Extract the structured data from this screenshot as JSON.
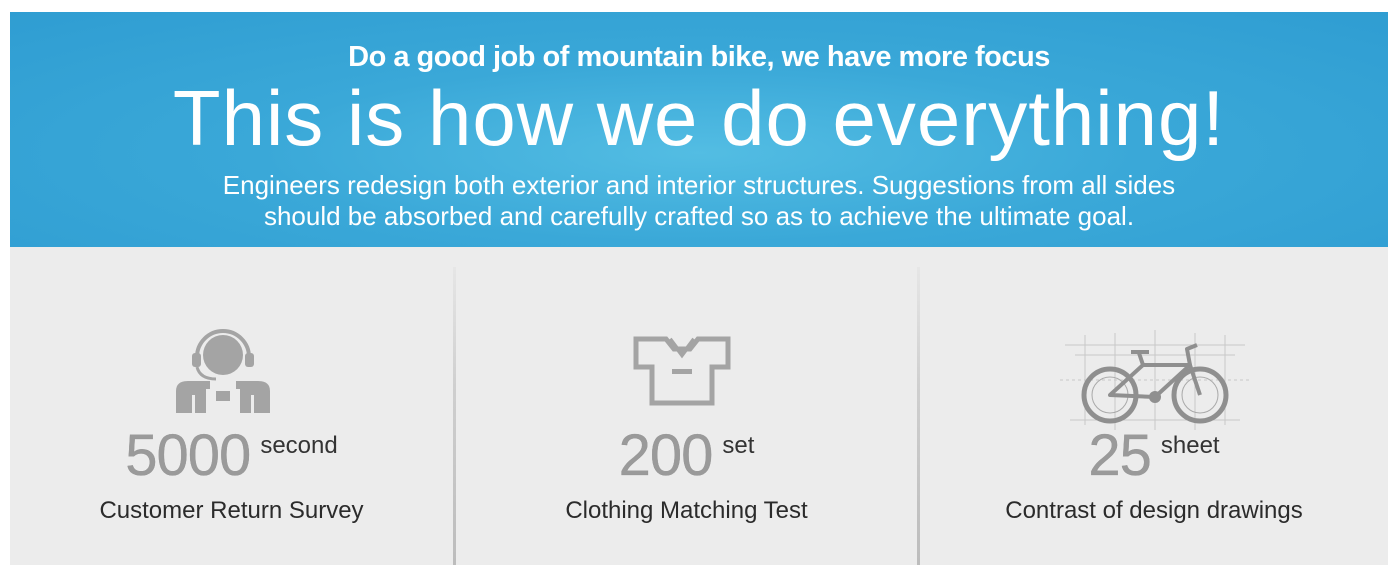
{
  "banner": {
    "tagline": "Do a good job of mountain bike, we have more focus",
    "headline": "This is how we do everything!",
    "subline_1": "Engineers redesign both exterior and interior structures. Suggestions from all sides",
    "subline_2": "should be absorbed and carefully crafted so as to achieve the ultimate goal.",
    "color": "#3aa8d8"
  },
  "stats": [
    {
      "icon": "customer-service-icon",
      "value": "5000",
      "unit": "second",
      "label": "Customer Return Survey"
    },
    {
      "icon": "tshirt-icon",
      "value": "200",
      "unit": "set",
      "label": "Clothing Matching Test"
    },
    {
      "icon": "bicycle-drawing-icon",
      "value": "25",
      "unit": "sheet",
      "label": "Contrast of design drawings"
    }
  ],
  "colors": {
    "panel_bg": "#ececec",
    "icon_gray": "#a4a4a4"
  }
}
